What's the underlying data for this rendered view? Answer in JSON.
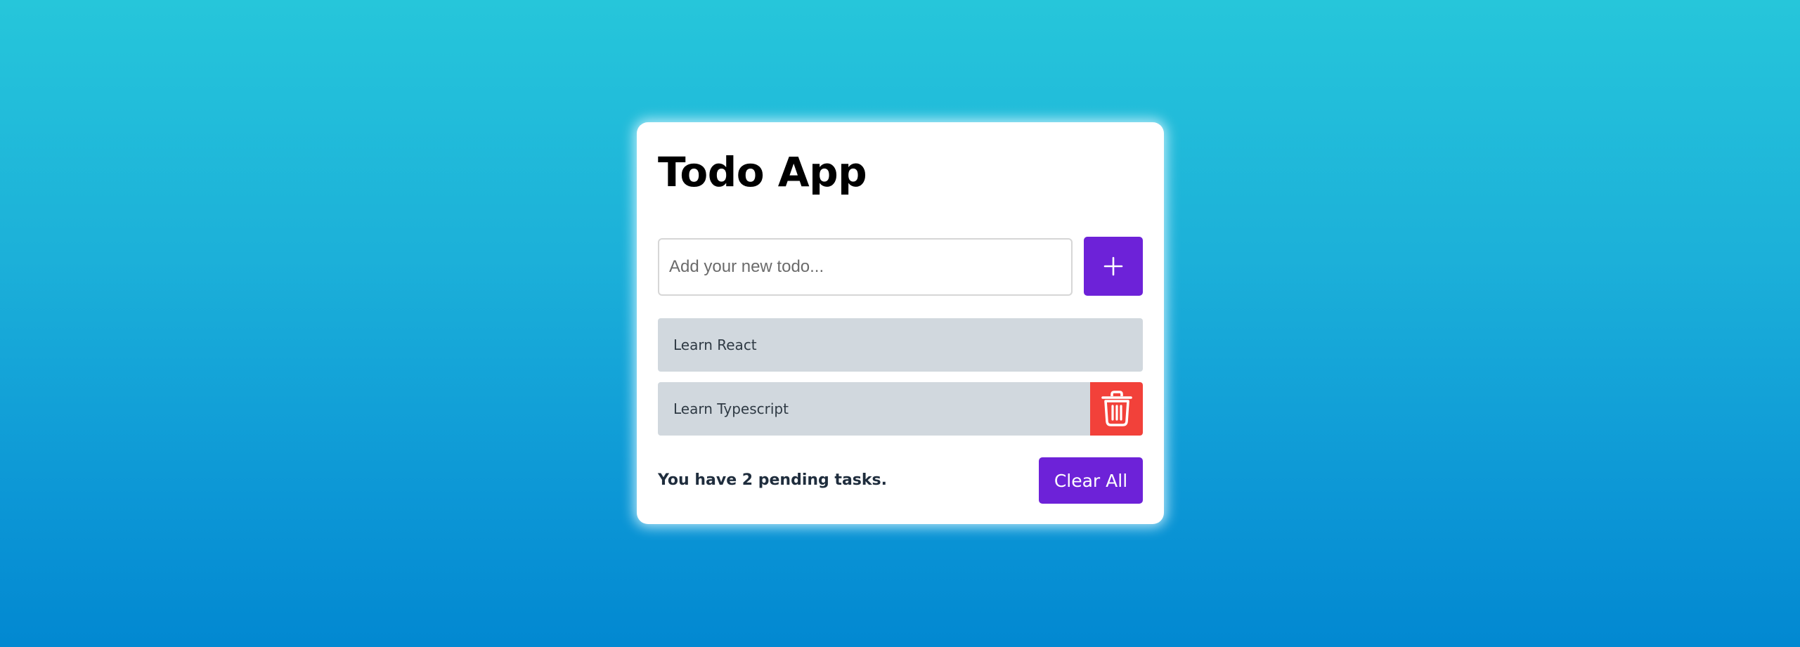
{
  "app": {
    "title": "Todo App"
  },
  "input": {
    "placeholder": "Add your new todo...",
    "value": ""
  },
  "add_button": {
    "icon": "plus-icon"
  },
  "todos": [
    {
      "label": "Learn React"
    },
    {
      "label": "Learn Typescript"
    }
  ],
  "delete_button": {
    "icon": "trash-icon"
  },
  "footer": {
    "pending_text": "You have 2 pending tasks.",
    "clear_label": "Clear All"
  },
  "colors": {
    "accent": "#6d22d8",
    "danger": "#f2413a",
    "item_bg": "#d1d8de",
    "background_top": "#26c6da",
    "background_bottom": "#0288d1"
  }
}
